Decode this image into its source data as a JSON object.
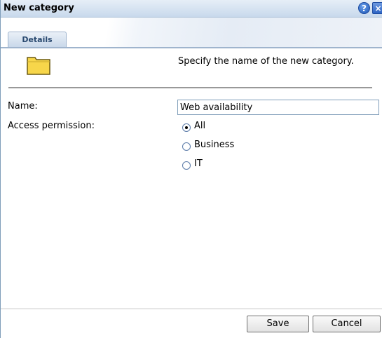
{
  "dialog": {
    "title": "New category",
    "help_glyph": "?",
    "close_glyph": "×"
  },
  "tabs": [
    {
      "label": "Details",
      "active": true
    }
  ],
  "header": {
    "icon": "folder-icon",
    "description": "Specify the name of the new category."
  },
  "form": {
    "name_label": "Name:",
    "name_value": "Web availability",
    "access_label": "Access permission:",
    "access_options": [
      {
        "label": "All",
        "checked": true
      },
      {
        "label": "Business",
        "checked": false
      },
      {
        "label": "IT",
        "checked": false
      }
    ]
  },
  "buttons": {
    "save": "Save",
    "cancel": "Cancel"
  },
  "colors": {
    "folder_fill": "#f7d64a",
    "folder_stroke": "#6b5a12",
    "title_bar": "#d2e0ef",
    "tab_border": "#9fb4cd"
  }
}
